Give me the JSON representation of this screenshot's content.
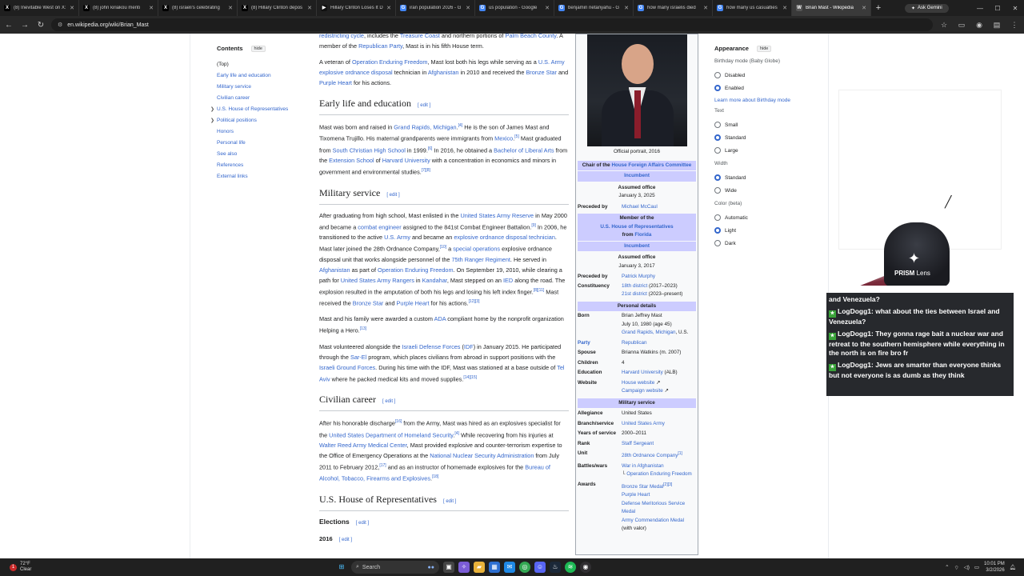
{
  "browser": {
    "tabs": [
      {
        "title": "(8) Inevitable West on X:",
        "fav": "X",
        "color": "#000000",
        "active": false
      },
      {
        "title": "(8) john kiriakou menti",
        "fav": "X",
        "color": "#000000",
        "active": false
      },
      {
        "title": "(8) israeli's celebrating",
        "fav": "X",
        "color": "#000000",
        "active": false
      },
      {
        "title": "(8) Hillary Clinton depos",
        "fav": "X",
        "color": "#000000",
        "active": false
      },
      {
        "title": "Hillary Clinton Loses It D",
        "fav": "▶",
        "color": "#111111",
        "active": false
      },
      {
        "title": "iran population 2026 - G",
        "fav": "G",
        "color": "#4285f4",
        "active": false
      },
      {
        "title": "us population - Google",
        "fav": "G",
        "color": "#4285f4",
        "active": false
      },
      {
        "title": "benjamin netanyahu - G",
        "fav": "G",
        "color": "#4285f4",
        "active": false
      },
      {
        "title": "how many israelis died",
        "fav": "G",
        "color": "#4285f4",
        "active": false
      },
      {
        "title": "how many us casualties",
        "fav": "G",
        "color": "#4285f4",
        "active": false
      },
      {
        "title": "Brian Mast - Wikipedia",
        "fav": "W",
        "color": "#555555",
        "active": true
      }
    ],
    "new_tab": "+",
    "ask_gemini": "Ask Gemini",
    "url": "en.wikipedia.org/wiki/Brian_Mast"
  },
  "toc": {
    "title": "Contents",
    "hide": "hide",
    "items": [
      {
        "label": "(Top)",
        "top": true,
        "expandable": false
      },
      {
        "label": "Early life and education",
        "top": false,
        "expandable": false
      },
      {
        "label": "Military service",
        "top": false,
        "expandable": false
      },
      {
        "label": "Civilian career",
        "top": false,
        "expandable": false
      },
      {
        "label": "U.S. House of Representatives",
        "top": false,
        "expandable": true
      },
      {
        "label": "Political positions",
        "top": false,
        "expandable": true
      },
      {
        "label": "Honors",
        "top": false,
        "expandable": false
      },
      {
        "label": "Personal life",
        "top": false,
        "expandable": false
      },
      {
        "label": "See also",
        "top": false,
        "expandable": false
      },
      {
        "label": "References",
        "top": false,
        "expandable": false
      },
      {
        "label": "External links",
        "top": false,
        "expandable": false
      }
    ]
  },
  "article": {
    "edit": "edit",
    "intro_cut": [
      {
        "t": "redistricting cycle",
        "l": true
      },
      {
        "t": ", includes the ",
        "l": false
      },
      {
        "t": "Treasure Coast",
        "l": true
      },
      {
        "t": " and northern portions of ",
        "l": false
      },
      {
        "t": "Palm Beach County",
        "l": true
      },
      {
        "t": ". A member of the ",
        "l": false
      },
      {
        "t": "Republican Party",
        "l": true
      },
      {
        "t": ", Mast is in his fifth House term.",
        "l": false
      }
    ],
    "intro2": [
      {
        "t": "A veteran of ",
        "l": false
      },
      {
        "t": "Operation Enduring Freedom",
        "l": true
      },
      {
        "t": ", Mast lost both his legs while serving as a ",
        "l": false
      },
      {
        "t": "U.S. Army",
        "l": true
      },
      {
        "t": " ",
        "l": false
      },
      {
        "t": "explosive ordnance disposal",
        "l": true
      },
      {
        "t": " technician in ",
        "l": false
      },
      {
        "t": "Afghanistan",
        "l": true
      },
      {
        "t": " in 2010 and received the ",
        "l": false
      },
      {
        "t": "Bronze Star",
        "l": true
      },
      {
        "t": " and ",
        "l": false
      },
      {
        "t": "Purple Heart",
        "l": true
      },
      {
        "t": " for his actions.",
        "l": false
      }
    ],
    "h_early": "Early life and education",
    "p_early": [
      {
        "t": "Mast was born and raised in ",
        "l": false
      },
      {
        "t": "Grand Rapids, Michigan",
        "l": true
      },
      {
        "t": ".",
        "l": false
      },
      {
        "t": "[4]",
        "s": true
      },
      {
        "t": " He is the son of James Mast and Tixomena Trujillo. His maternal grandparents were immigrants from ",
        "l": false
      },
      {
        "t": "Mexico",
        "l": true
      },
      {
        "t": ".",
        "l": false
      },
      {
        "t": "[5]",
        "s": true
      },
      {
        "t": " Mast graduated from ",
        "l": false
      },
      {
        "t": "South Christian High School",
        "l": true
      },
      {
        "t": " in 1999.",
        "l": false
      },
      {
        "t": "[6]",
        "s": true
      },
      {
        "t": " In 2016, he obtained a ",
        "l": false
      },
      {
        "t": "Bachelor of Liberal Arts",
        "l": true
      },
      {
        "t": " from the ",
        "l": false
      },
      {
        "t": "Extension School",
        "l": true
      },
      {
        "t": " of ",
        "l": false
      },
      {
        "t": "Harvard University",
        "l": true
      },
      {
        "t": " with a concentration in economics and minors in government and environmental studies.",
        "l": false
      },
      {
        "t": "[7][8]",
        "s": true
      }
    ],
    "h_military": "Military service",
    "p_mil1": [
      {
        "t": "After graduating from high school, Mast enlisted in the ",
        "l": false
      },
      {
        "t": "United States Army Reserve",
        "l": true
      },
      {
        "t": " in May 2000 and became a ",
        "l": false
      },
      {
        "t": "combat engineer",
        "l": true
      },
      {
        "t": " assigned to the 841st Combat Engineer Battalion.",
        "l": false
      },
      {
        "t": "[9]",
        "s": true
      },
      {
        "t": " In 2006, he transitioned to the active ",
        "l": false
      },
      {
        "t": "U.S. Army",
        "l": true
      },
      {
        "t": " and became an ",
        "l": false
      },
      {
        "t": "explosive ordnance disposal technician",
        "l": true
      },
      {
        "t": ". Mast later joined the 28th Ordnance Company,",
        "l": false
      },
      {
        "t": "[10]",
        "s": true
      },
      {
        "t": " a ",
        "l": false
      },
      {
        "t": "special operations",
        "l": true
      },
      {
        "t": " explosive ordnance disposal unit that works alongside personnel of the ",
        "l": false
      },
      {
        "t": "75th Ranger Regiment",
        "l": true
      },
      {
        "t": ". He served in ",
        "l": false
      },
      {
        "t": "Afghanistan",
        "l": true
      },
      {
        "t": " as part of ",
        "l": false
      },
      {
        "t": "Operation Enduring Freedom",
        "l": true
      },
      {
        "t": ". On September 19, 2010, while clearing a path for ",
        "l": false
      },
      {
        "t": "United States Army Rangers",
        "l": true
      },
      {
        "t": " in ",
        "l": false
      },
      {
        "t": "Kandahar",
        "l": true
      },
      {
        "t": ", Mast stepped on an ",
        "l": false
      },
      {
        "t": "IED",
        "l": true
      },
      {
        "t": " along the road. The explosion resulted in the amputation of both his legs and losing his left index finger.",
        "l": false
      },
      {
        "t": "[8][11]",
        "s": true
      },
      {
        "t": " Mast received the ",
        "l": false
      },
      {
        "t": "Bronze Star",
        "l": true
      },
      {
        "t": " and ",
        "l": false
      },
      {
        "t": "Purple Heart",
        "l": true
      },
      {
        "t": " for his actions.",
        "l": false
      },
      {
        "t": "[12][3]",
        "s": true
      }
    ],
    "p_mil2": [
      {
        "t": "Mast and his family were awarded a custom ",
        "l": false
      },
      {
        "t": "ADA",
        "l": true
      },
      {
        "t": " compliant home by the nonprofit organization Helping a Hero.",
        "l": false
      },
      {
        "t": "[13]",
        "s": true
      }
    ],
    "p_mil3": [
      {
        "t": "Mast volunteered alongside the ",
        "l": false
      },
      {
        "t": "Israeli Defense Forces",
        "l": true
      },
      {
        "t": " (",
        "l": false
      },
      {
        "t": "IDF",
        "l": true
      },
      {
        "t": ") in January 2015. He participated through the ",
        "l": false
      },
      {
        "t": "Sar-El",
        "l": true
      },
      {
        "t": " program, which places civilians from abroad in support positions with the ",
        "l": false
      },
      {
        "t": "Israeli Ground Forces",
        "l": true
      },
      {
        "t": ". During his time with the IDF, Mast was stationed at a base outside of ",
        "l": false
      },
      {
        "t": "Tel Aviv",
        "l": true
      },
      {
        "t": " where he packed medical kits and moved supplies.",
        "l": false
      },
      {
        "t": "[14][15]",
        "s": true
      }
    ],
    "h_civilian": "Civilian career",
    "p_civ": [
      {
        "t": "After his honorable discharge",
        "l": false
      },
      {
        "t": "[16]",
        "s": true
      },
      {
        "t": " from the Army, Mast was hired as an explosives specialist for the ",
        "l": false
      },
      {
        "t": "United States Department of Homeland Security",
        "l": true
      },
      {
        "t": ".",
        "l": false
      },
      {
        "t": "[4]",
        "s": true
      },
      {
        "t": " While recovering from his injuries at ",
        "l": false
      },
      {
        "t": "Walter Reed Army Medical Center",
        "l": true
      },
      {
        "t": ", Mast provided explosive and counter-terrorism expertise to the Office of Emergency Operations at the ",
        "l": false
      },
      {
        "t": "National Nuclear Security Administration",
        "l": true
      },
      {
        "t": " from July 2011 to February 2012,",
        "l": false
      },
      {
        "t": "[17]",
        "s": true
      },
      {
        "t": " and as an instructor of homemade explosives for the ",
        "l": false
      },
      {
        "t": "Bureau of Alcohol, Tobacco, Firearms and Explosives",
        "l": true
      },
      {
        "t": ".",
        "l": false
      },
      {
        "t": "[18]",
        "s": true
      }
    ],
    "h_house": "U.S. House of Representatives",
    "h_elections": "Elections",
    "h_2016": "2016"
  },
  "infobox": {
    "caption": "Official portrait, 2016",
    "chair_prefix": "Chair of the ",
    "chair_link": "House Foreign Affairs Committee",
    "incumbent": "Incumbent",
    "assumed_office": "Assumed office",
    "chair_date": "January 3, 2025",
    "preceded_by": "Preceded by",
    "chair_prev": "Michael McCaul",
    "member_of": "Member of the",
    "member_link": "U.S. House of Representatives",
    "from": "from ",
    "from_link": "Florida",
    "member_date": "January 3, 2017",
    "member_prev": "Patrick Murphy",
    "constituency": "Constituency",
    "const_1": "18th district",
    "const_1_years": " (2017–2023)",
    "const_2": "21st district",
    "const_2_years": " (2023–present)",
    "personal_details": "Personal details",
    "born": "Born",
    "born_name": "Brian Jeffrey Mast",
    "born_date": "July 10, 1980 (age 45)",
    "born_place": "Grand Rapids, Michigan",
    "born_country": ", U.S.",
    "party": "Party",
    "party_val": "Republican",
    "spouse": "Spouse",
    "spouse_val": "Brianna Watkins (m. 2007)",
    "children": "Children",
    "children_val": "4",
    "education": "Education",
    "education_val": "Harvard University",
    "education_suffix": " (ALB)",
    "website": "Website",
    "website_1": "House website",
    "website_2": "Campaign website",
    "military_service": "Military service",
    "allegiance": "Allegiance",
    "allegiance_val": "United States",
    "branch": "Branch/service",
    "branch_val": "United States Army",
    "years": "Years of service",
    "years_val": "2000–2011",
    "rank": "Rank",
    "rank_val": "Staff Sergeant",
    "unit": "Unit",
    "unit_val": "28th Ordnance Company",
    "unit_sup": "[1]",
    "battles": "Battles/wars",
    "battles_1": "War in Afghanistan",
    "battles_2": "Operation Enduring Freedom",
    "awards": "Awards",
    "awards_1": "Bronze Star Medal",
    "awards_1_sup": "[2][3]",
    "awards_2": "Purple Heart",
    "awards_3": "Defense Meritorious Service Medal",
    "awards_4": "Army Commendation Medal",
    "awards_4_suffix": "(with valor)"
  },
  "appearance": {
    "title": "Appearance",
    "hide": "hide",
    "birthday_label": "Birthday mode (Baby Globe)",
    "birthday_options": [
      {
        "label": "Disabled",
        "on": false
      },
      {
        "label": "Enabled",
        "on": true
      }
    ],
    "birthday_link": "Learn more about Birthday mode",
    "text_label": "Text",
    "text_options": [
      {
        "label": "Small",
        "on": false
      },
      {
        "label": "Standard",
        "on": true
      },
      {
        "label": "Large",
        "on": false
      }
    ],
    "width_label": "Width",
    "width_options": [
      {
        "label": "Standard",
        "on": true
      },
      {
        "label": "Wide",
        "on": false
      }
    ],
    "color_label": "Color (beta)",
    "color_options": [
      {
        "label": "Automatic",
        "on": false
      },
      {
        "label": "Light",
        "on": true
      },
      {
        "label": "Dark",
        "on": false
      }
    ]
  },
  "overlay": {
    "prism": "PRISM",
    "prism_suffix": " Lens",
    "chat_cut": "and Venezuela?",
    "chat": [
      {
        "user": "LogDogg1",
        "text": "what about the ties between Israel and Venezuela?"
      },
      {
        "user": "LogDogg1",
        "text": "They gonna rage bait a nuclear war and retreat to the southern hemisphere while everything in the north is on fire bro fr"
      },
      {
        "user": "LogDogg1",
        "text": "Jews are smarter than everyone thinks but not everyone is as dumb as they think"
      }
    ]
  },
  "taskbar": {
    "weather_temp": "72°F",
    "weather_desc": "Clear",
    "search": "Search",
    "time": "10:01 PM",
    "date": "3/2/2026"
  }
}
